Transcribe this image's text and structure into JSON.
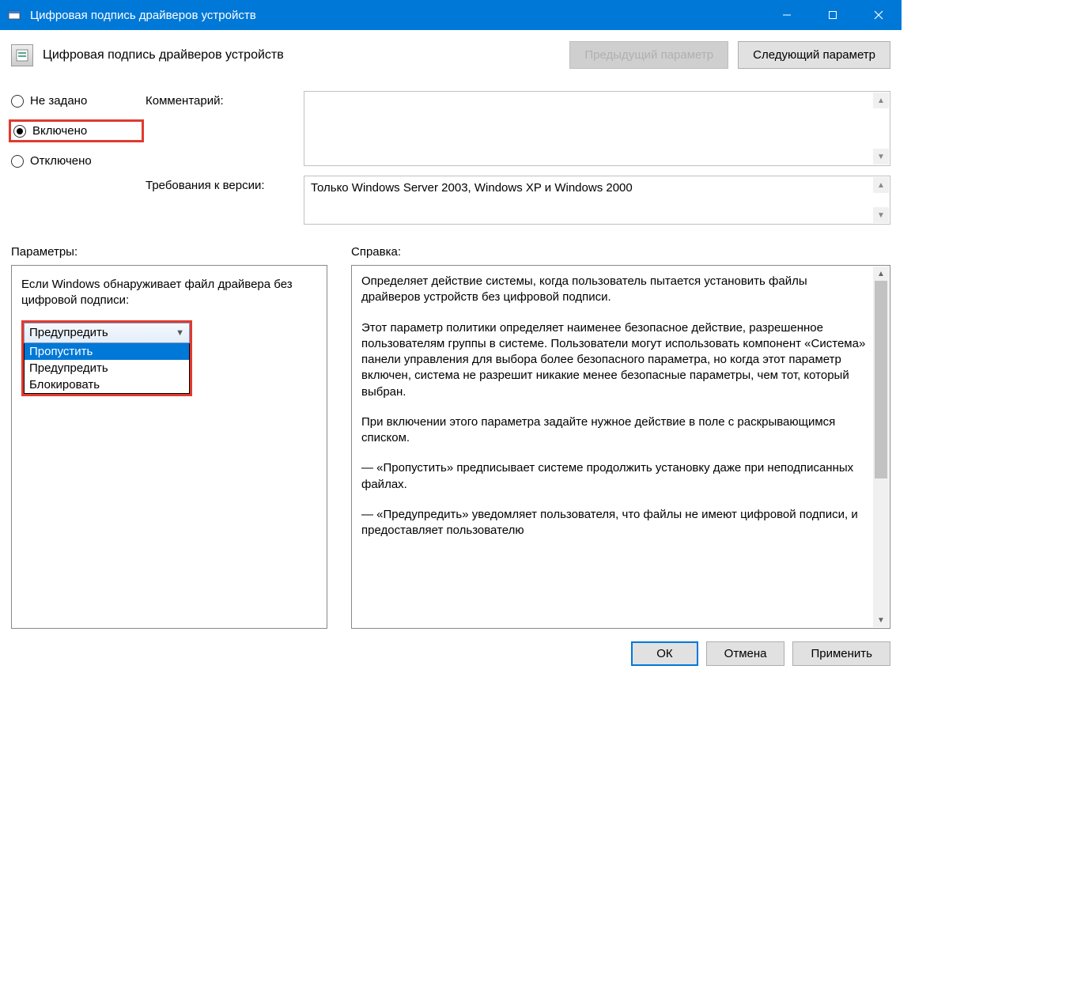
{
  "window": {
    "title": "Цифровая подпись драйверов устройств"
  },
  "header": {
    "policy_title": "Цифровая подпись драйверов устройств",
    "prev_btn": "Предыдущий параметр",
    "next_btn": "Следующий параметр"
  },
  "state_radios": {
    "not_configured": "Не задано",
    "enabled": "Включено",
    "disabled": "Отключено"
  },
  "labels": {
    "comment": "Комментарий:",
    "requirements": "Требования к версии:",
    "parameters": "Параметры:",
    "help": "Справка:"
  },
  "requirements_text": "Только Windows Server 2003, Windows XP и Windows 2000",
  "params": {
    "prompt": "Если Windows обнаруживает файл драйвера без цифровой подписи:",
    "selected": "Предупредить",
    "options": [
      "Пропустить",
      "Предупредить",
      "Блокировать"
    ]
  },
  "help_paragraphs": [
    "Определяет действие системы, когда пользователь пытается установить файлы драйверов устройств без цифровой подписи.",
    "Этот параметр политики определяет наименее безопасное действие, разрешенное пользователям группы в системе. Пользователи могут использовать компонент «Система» панели управления для выбора более безопасного параметра, но когда этот параметр включен, система не разрешит никакие менее безопасные параметры, чем тот, который выбран.",
    "При включении этого параметра задайте нужное действие в поле с раскрывающимся списком.",
    "— «Пропустить» предписывает системе продолжить установку даже при неподписанных файлах.",
    "— «Предупредить» уведомляет пользователя, что файлы не имеют цифровой подписи, и предоставляет пользователю"
  ],
  "footer": {
    "ok": "ОК",
    "cancel": "Отмена",
    "apply": "Применить"
  }
}
